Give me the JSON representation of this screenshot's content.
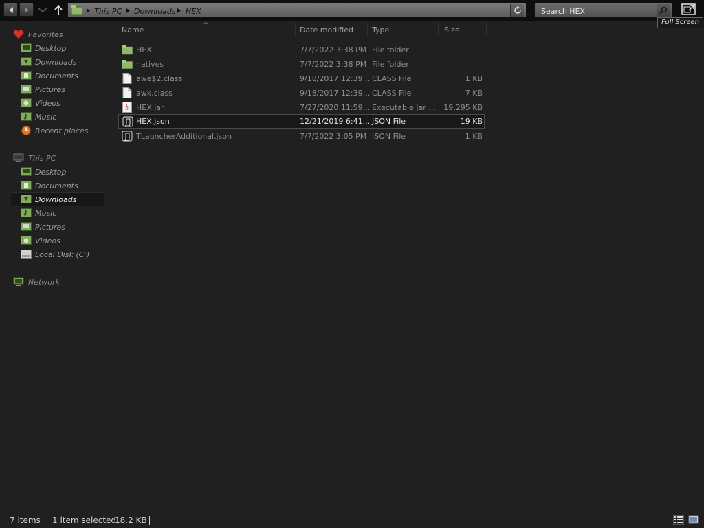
{
  "address": {
    "crumbs": [
      "This PC",
      "Downloads",
      "HEX"
    ]
  },
  "search": {
    "placeholder": "Search HEX"
  },
  "tooltip": {
    "text": "Full Screen"
  },
  "nav": {
    "favorites": {
      "label": "Favorites",
      "items": [
        "Desktop",
        "Downloads",
        "Documents",
        "Pictures",
        "Videos",
        "Music",
        "Recent places"
      ]
    },
    "this_pc": {
      "label": "This PC",
      "items": [
        "Desktop",
        "Documents",
        "Downloads",
        "Music",
        "Pictures",
        "Videos",
        "Local Disk (C:)"
      ],
      "selected": "Downloads"
    },
    "network": {
      "label": "Network"
    }
  },
  "columns": {
    "name": "Name",
    "date": "Date modified",
    "type": "Type",
    "size": "Size"
  },
  "files": [
    {
      "name": "HEX",
      "date": "7/7/2022 3:38 PM",
      "type": "File folder",
      "size": "",
      "icon": "folder-icon"
    },
    {
      "name": "natives",
      "date": "7/7/2022 3:38 PM",
      "type": "File folder",
      "size": "",
      "icon": "folder-icon"
    },
    {
      "name": "awe$2.class",
      "date": "9/18/2017 12:39...",
      "type": "CLASS File",
      "size": "1 KB",
      "icon": "file-icon"
    },
    {
      "name": "awk.class",
      "date": "9/18/2017 12:39...",
      "type": "CLASS File",
      "size": "7 KB",
      "icon": "file-icon"
    },
    {
      "name": "HEX.jar",
      "date": "7/27/2020 11:59...",
      "type": "Executable Jar ...",
      "size": "19,295 KB",
      "icon": "java-icon"
    },
    {
      "name": "HEX.json",
      "date": "12/21/2019 6:41...",
      "type": "JSON File",
      "size": "19 KB",
      "icon": "script-icon",
      "selected": true
    },
    {
      "name": "TLauncherAdditional.json",
      "date": "7/7/2022 3:05 PM",
      "type": "JSON File",
      "size": "1 KB",
      "icon": "script-icon"
    }
  ],
  "status": {
    "item_count": "7 items",
    "selection": "1 item selected",
    "size": "18.2 KB"
  }
}
